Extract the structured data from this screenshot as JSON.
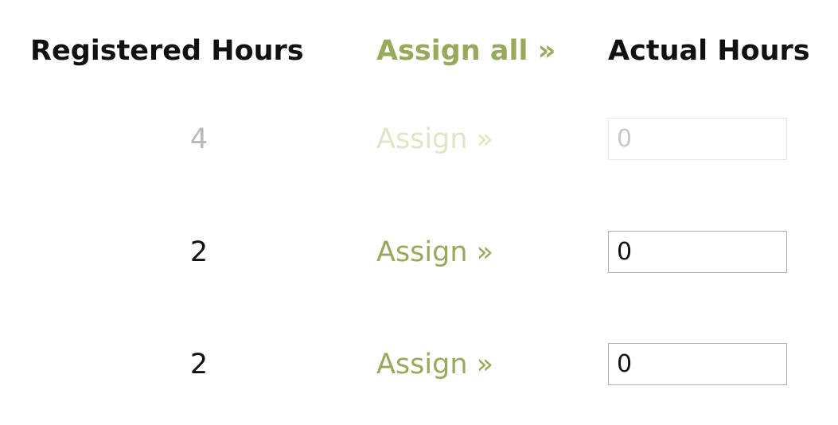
{
  "headers": {
    "registered_hours": "Registered Hours",
    "assign_all": "Assign all »",
    "actual_hours": "Actual Hours"
  },
  "rows": [
    {
      "registered_hours": "4",
      "assign_label": "Assign »",
      "actual_hours_value": "0",
      "disabled": true
    },
    {
      "registered_hours": "2",
      "assign_label": "Assign »",
      "actual_hours_value": "0",
      "disabled": false
    },
    {
      "registered_hours": "2",
      "assign_label": "Assign »",
      "actual_hours_value": "0",
      "disabled": false
    }
  ],
  "colors": {
    "link": "#97aa5c",
    "link_disabled": "#dfe5c8",
    "text": "#111111",
    "text_disabled": "#b9b9b9"
  }
}
